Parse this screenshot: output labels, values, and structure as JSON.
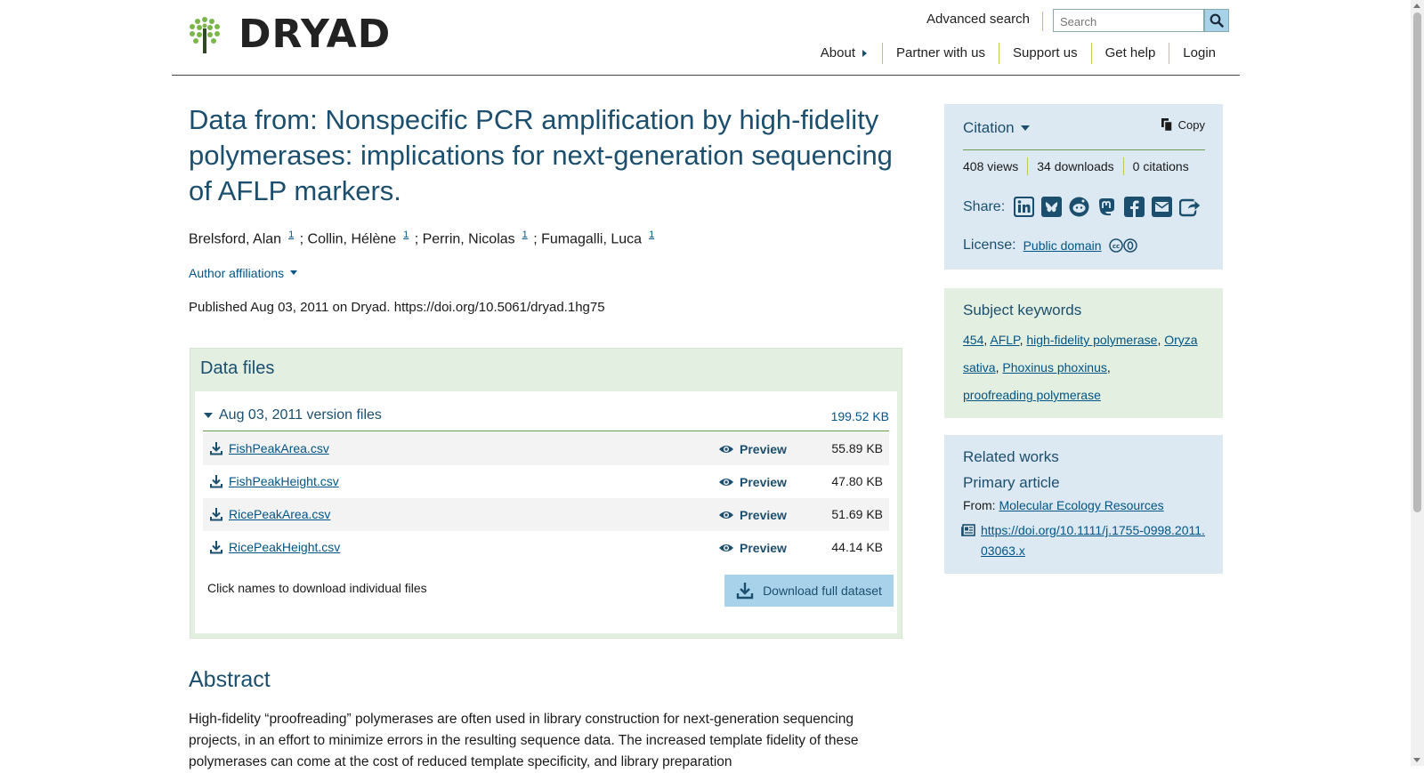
{
  "header": {
    "logo_text": "DRYAD",
    "advanced_search": "Advanced search",
    "search_placeholder": "Search",
    "nav": [
      "About",
      "Partner with us",
      "Support us",
      "Get help",
      "Login"
    ]
  },
  "dataset": {
    "title": "Data from: Nonspecific PCR amplification by high-fidelity polymerases: implications for next-generation sequencing of AFLP markers.",
    "authors": [
      {
        "name": "Brelsford, Alan",
        "aff": "1",
        "sep": " ;"
      },
      {
        "name": "Collin, Hélène",
        "aff": "1",
        "sep": " ;"
      },
      {
        "name": "Perrin, Nicolas",
        "aff": "1",
        "sep": " ;"
      },
      {
        "name": "Fumagalli, Luca",
        "aff": "1",
        "sep": ""
      }
    ],
    "author_affiliations": "Author affiliations",
    "published": "Published Aug 03, 2011 on Dryad. https://doi.org/10.5061/dryad.1hg75"
  },
  "files": {
    "heading": "Data files",
    "version_label": "Aug 03, 2011 version files",
    "version_size": "199.52 KB",
    "preview_label": "Preview",
    "list": [
      {
        "name": "FishPeakArea.csv",
        "size": "55.89 KB"
      },
      {
        "name": "FishPeakHeight.csv",
        "size": "47.80 KB"
      },
      {
        "name": "RicePeakArea.csv",
        "size": "51.69 KB"
      },
      {
        "name": "RicePeakHeight.csv",
        "size": "44.14 KB"
      }
    ],
    "note": "Click names to download individual files",
    "download_full": "Download full dataset"
  },
  "abstract": {
    "heading": "Abstract",
    "text": "High-fidelity “proofreading” polymerases are often used in library construction for next-generation sequencing projects, in an effort to minimize errors in the resulting sequence data. The increased template fidelity of these polymerases can come at the cost of reduced template specificity, and library preparation"
  },
  "sidebar": {
    "citation": {
      "label": "Citation",
      "copy": "Copy",
      "views": "408 views",
      "downloads": "34 downloads",
      "citations": "0 citations",
      "share_label": "Share:",
      "license_label": "License:",
      "license_value": "Public domain"
    },
    "keywords": {
      "heading": "Subject keywords",
      "items": [
        "454",
        "AFLP",
        "high-fidelity polymerase",
        "Oryza sativa",
        "Phoxinus phoxinus",
        "proofreading polymerase"
      ]
    },
    "related": {
      "heading": "Related works",
      "subheading": "Primary article",
      "from_label": "From:",
      "journal": "Molecular Ecology Resources",
      "doi": "https://doi.org/10.1111/j.1755-0998.2011.03063.x"
    }
  },
  "colors": {
    "title_blue": "#1c4f6e",
    "link_blue": "#005586",
    "green_panel": "#e3efe0",
    "blue_panel": "#dce9f2",
    "accent_green": "#6a9c4f",
    "button_blue": "#a7d2ea"
  }
}
